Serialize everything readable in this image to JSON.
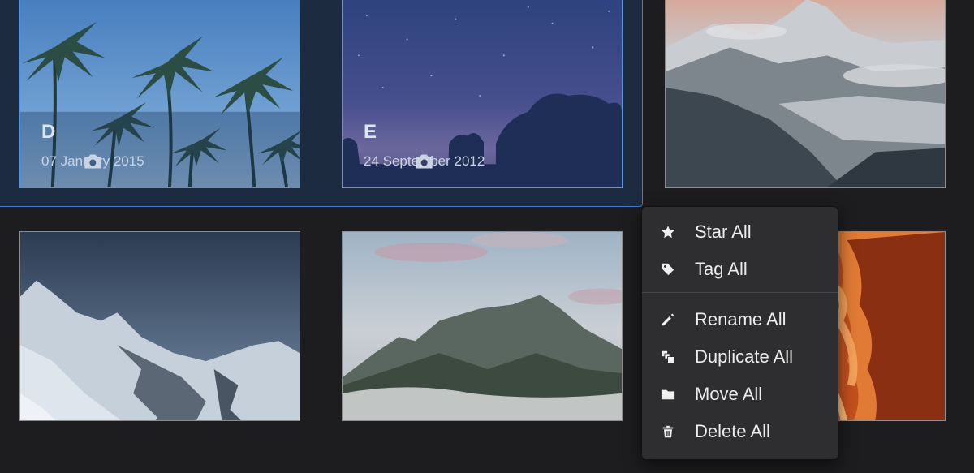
{
  "photos": [
    {
      "letter": "D",
      "date": "07 January 2015",
      "selected": true,
      "scene": "palm-trees"
    },
    {
      "letter": "E",
      "date": "24 September 2012",
      "selected": true,
      "scene": "starry-night"
    },
    {
      "scene": "snowy-mountain",
      "selected": false
    },
    {
      "scene": "snowy-peaks",
      "selected": false
    },
    {
      "scene": "misty-mountain-lake",
      "selected": false
    },
    {
      "scene": "antelope-canyon",
      "selected": false
    }
  ],
  "context_menu": {
    "items": [
      {
        "label": "Star All",
        "icon": "star-icon"
      },
      {
        "label": "Tag All",
        "icon": "tag-icon"
      },
      {
        "label": "Rename All",
        "icon": "pencil-icon"
      },
      {
        "label": "Duplicate All",
        "icon": "duplicate-icon"
      },
      {
        "label": "Move All",
        "icon": "folder-icon"
      },
      {
        "label": "Delete All",
        "icon": "trash-icon"
      }
    ]
  },
  "colors": {
    "background": "#1d1d1f",
    "selection_accent": "#4b97ef",
    "menu_background": "#2e2e30"
  }
}
